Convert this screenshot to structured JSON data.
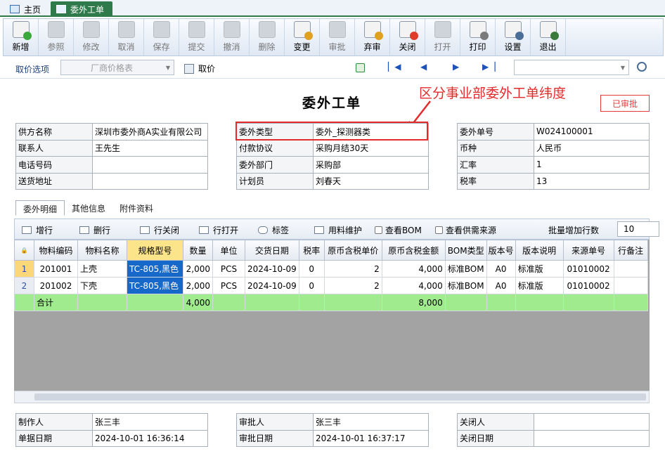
{
  "tabs": {
    "home": "主页",
    "active": "委外工单"
  },
  "toolbar": [
    {
      "id": "add",
      "label": "新增",
      "enabled": true
    },
    {
      "id": "ref",
      "label": "参照",
      "enabled": false
    },
    {
      "id": "edit",
      "label": "修改",
      "enabled": false
    },
    {
      "id": "cancel",
      "label": "取消",
      "enabled": false
    },
    {
      "id": "save",
      "label": "保存",
      "enabled": false
    },
    {
      "id": "submit",
      "label": "提交",
      "enabled": false
    },
    {
      "id": "revoke",
      "label": "撤消",
      "enabled": false
    },
    {
      "id": "delete",
      "label": "删除",
      "enabled": false
    },
    {
      "id": "change",
      "label": "变更",
      "enabled": true
    },
    {
      "id": "approve",
      "label": "审批",
      "enabled": false
    },
    {
      "id": "unapprove",
      "label": "弃审",
      "enabled": true
    },
    {
      "id": "close",
      "label": "关闭",
      "enabled": true
    },
    {
      "id": "open",
      "label": "打开",
      "enabled": false
    },
    {
      "id": "print",
      "label": "打印",
      "enabled": true
    },
    {
      "id": "settings",
      "label": "设置",
      "enabled": true
    },
    {
      "id": "exit",
      "label": "退出",
      "enabled": true
    }
  ],
  "options": {
    "label": "取价选项",
    "combo_value": "厂商价格表",
    "fetch": "取价"
  },
  "doc": {
    "title": "委外工单",
    "annotation": "区分事业部委外工单纬度",
    "status": "已审批"
  },
  "header": {
    "left": [
      {
        "label": "供方名称",
        "value": "深圳市委外商A实业有限公司"
      },
      {
        "label": "联系人",
        "value": "王先生"
      },
      {
        "label": "电话号码",
        "value": ""
      },
      {
        "label": "送货地址",
        "value": ""
      }
    ],
    "mid": [
      {
        "label": "委外类型",
        "value": "委外_探测器类"
      },
      {
        "label": "付款协议",
        "value": "采购月结30天"
      },
      {
        "label": "委外部门",
        "value": "采购部"
      },
      {
        "label": "计划员",
        "value": "刘春天"
      }
    ],
    "right": [
      {
        "label": "委外单号",
        "value": "W024100001"
      },
      {
        "label": "币种",
        "value": "人民币"
      },
      {
        "label": "汇率",
        "value": "1"
      },
      {
        "label": "税率",
        "value": "13"
      }
    ]
  },
  "subtabs": [
    "委外明细",
    "其他信息",
    "附件资料"
  ],
  "gridbar": {
    "add_row": "增行",
    "del_row": "删行",
    "row_close": "行关闭",
    "row_open": "行打开",
    "tag": "标签",
    "material": "用料维护",
    "view_bom": "查看BOM",
    "view_source": "查看供需来源",
    "batch_label": "批量增加行数",
    "batch_value": "10"
  },
  "grid": {
    "columns": [
      "物料编码",
      "物料名称",
      "规格型号",
      "数量",
      "单位",
      "交货日期",
      "税率",
      "原币含税单价",
      "原币含税金额",
      "BOM类型",
      "版本号",
      "版本说明",
      "来源单号",
      "行备注"
    ],
    "rows": [
      [
        "201001",
        "上壳",
        "TC-805,黑色",
        "2,000",
        "PCS",
        "2024-10-09",
        "0",
        "2",
        "4,000",
        "标准BOM",
        "A0",
        "标准版",
        "01010002",
        ""
      ],
      [
        "201002",
        "下壳",
        "TC-805,黑色",
        "2,000",
        "PCS",
        "2024-10-09",
        "0",
        "2",
        "4,000",
        "标准BOM",
        "A0",
        "标准版",
        "01010002",
        ""
      ]
    ],
    "row_numbers": [
      "1",
      "2"
    ],
    "sum": {
      "label": "合计",
      "qty": "4,000",
      "amount": "8,000"
    }
  },
  "footer": {
    "left": [
      {
        "label": "制作人",
        "value": "张三丰"
      },
      {
        "label": "单据日期",
        "value": "2024-10-01 16:36:14"
      }
    ],
    "mid": [
      {
        "label": "审批人",
        "value": "张三丰"
      },
      {
        "label": "审批日期",
        "value": "2024-10-01 16:37:17"
      }
    ],
    "right": [
      {
        "label": "关闭人",
        "value": ""
      },
      {
        "label": "关闭日期",
        "value": ""
      }
    ]
  }
}
